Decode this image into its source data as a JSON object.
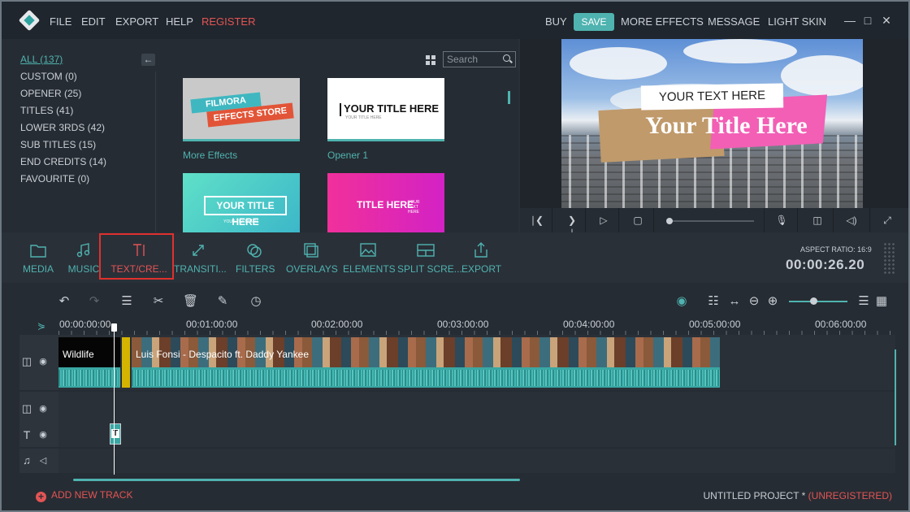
{
  "menubar": {
    "file": "FILE",
    "edit": "EDIT",
    "export": "EXPORT",
    "help": "HELP",
    "register": "REGISTER",
    "buy": "BUY",
    "save": "SAVE",
    "more_effects": "MORE EFFECTS",
    "message": "MESSAGE",
    "light_skin": "LIGHT SKIN"
  },
  "library": {
    "categories": [
      "ALL (137)",
      "CUSTOM (0)",
      "OPENER (25)",
      "TITLES (41)",
      "LOWER 3RDS (42)",
      "SUB TITLES (15)",
      "END CREDITS (14)",
      "FAVOURITE (0)"
    ],
    "search_placeholder": "Search",
    "thumbs": [
      {
        "label": "More Effects",
        "line1": "FILMORA",
        "line2": "EFFECTS STORE"
      },
      {
        "label": "Opener 1",
        "title": "YOUR TITLE HERE",
        "sub": "YOUR TITLE HERE"
      },
      {
        "title": "YOUR TITLE HERE",
        "sub": "YOUR TEXT HERE"
      },
      {
        "title": "TITLE HERE",
        "sub": "YOUR TEXT HERE"
      }
    ]
  },
  "preview": {
    "overlay_small": "YOUR TEXT HERE",
    "overlay_title": "Your Title Here"
  },
  "toolbar": {
    "tools": [
      "MEDIA",
      "MUSIC",
      "TEXT/CRE...",
      "TRANSITI...",
      "FILTERS",
      "OVERLAYS",
      "ELEMENTS",
      "SPLIT SCRE...",
      "EXPORT"
    ],
    "aspect_ratio": "ASPECT RATIO: 16:9",
    "timecode": "00:00:26.20"
  },
  "timeline": {
    "ruler": [
      "00:00:00:00",
      "00:01:00:00",
      "00:02:00:00",
      "00:03:00:00",
      "00:04:00:00",
      "00:05:00:00",
      "00:06:00:00"
    ],
    "clip1": "Wildlife",
    "clip2": "Luis Fonsi - Despacito ft. Daddy Yankee",
    "text_clip": "T",
    "add_track": "ADD NEW TRACK",
    "project_name": "UNTITLED PROJECT *",
    "project_status": "(UNREGISTERED)"
  }
}
